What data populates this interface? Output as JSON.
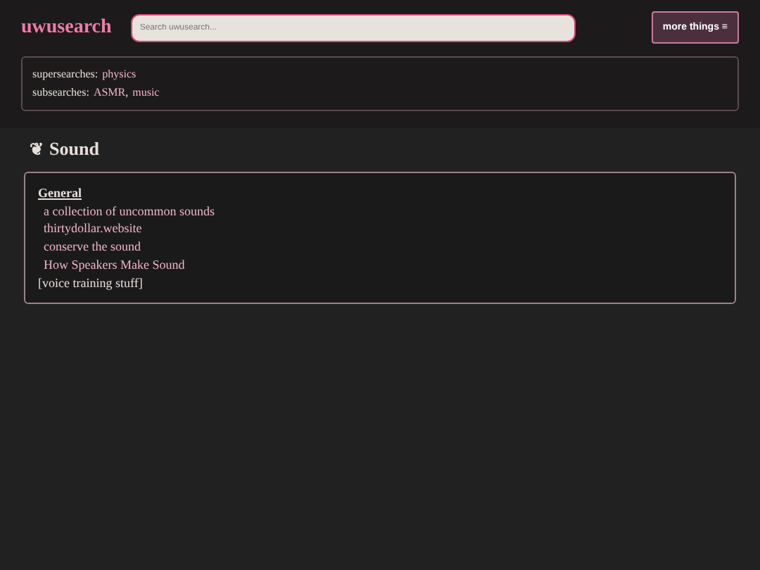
{
  "logo": "uwusearch",
  "search": {
    "placeholder": "Search uwusearch..."
  },
  "menu_button": "more things ≡",
  "related": [
    {
      "label": "supersearches:",
      "links": [
        "physics"
      ]
    },
    {
      "label": "subsearches:",
      "links": [
        "ASMR",
        "music"
      ],
      "separator": ","
    }
  ],
  "heading": {
    "glyph": "❦",
    "title": "Sound"
  },
  "sections": [
    {
      "kind": "group",
      "title": "General",
      "links": [
        "a collection of uncommon sounds",
        "thirtydollar.website",
        "conserve the sound",
        "How Speakers Make Sound"
      ]
    },
    {
      "kind": "collapsed",
      "title": "[voice training stuff]"
    }
  ]
}
